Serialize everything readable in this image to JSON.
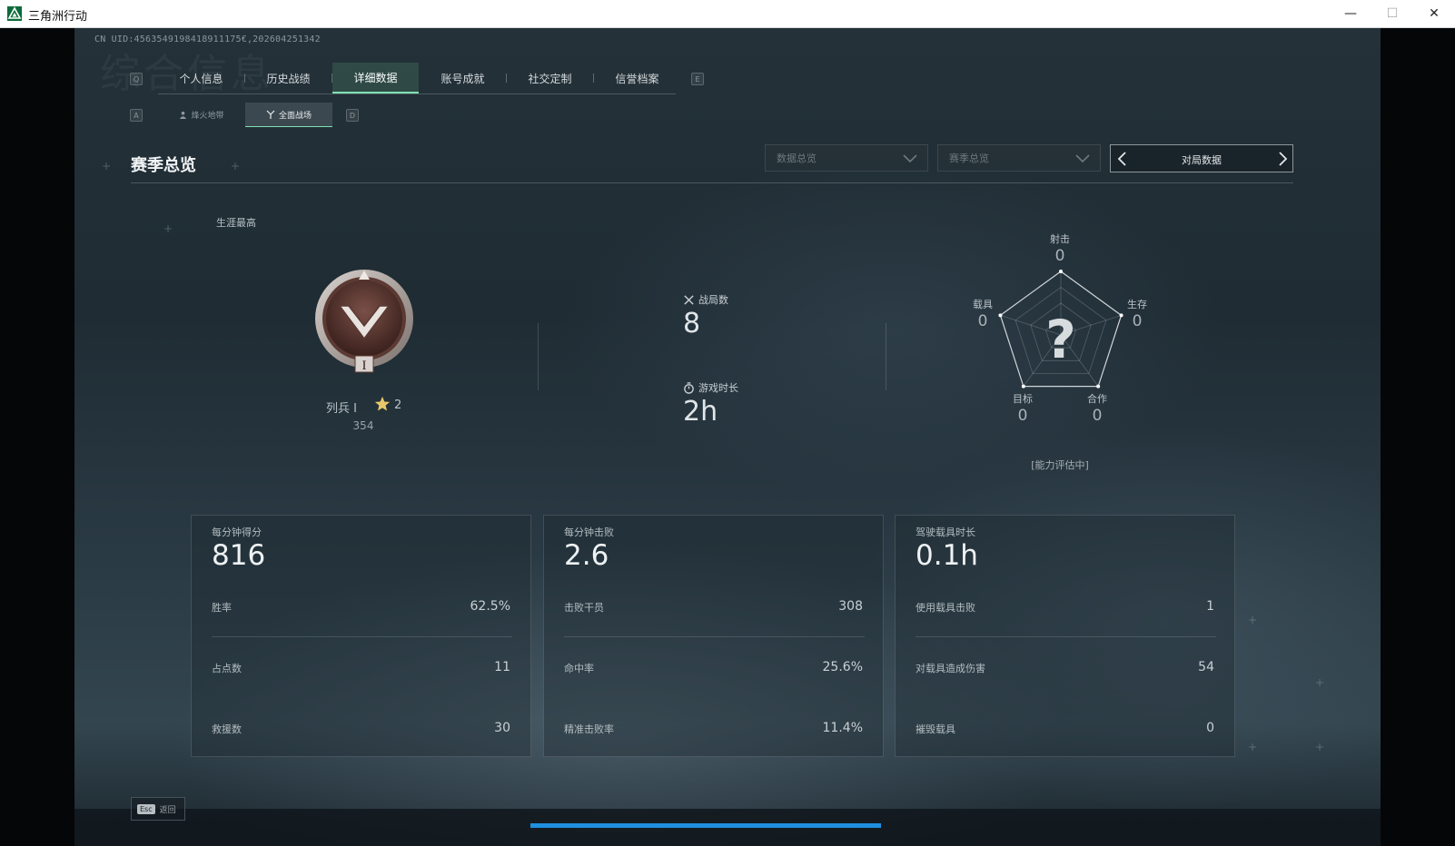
{
  "window": {
    "title": "三角洲行动",
    "min": "—",
    "max": "☐",
    "close": "✕"
  },
  "header": {
    "uid": "CN UID:4563549198418911175€,202604251342",
    "ghost_title": "综合信息"
  },
  "tabs": {
    "key_left": "Q",
    "key_right": "E",
    "items": [
      {
        "label": "个人信息"
      },
      {
        "label": "历史战绩"
      },
      {
        "label": "详细数据"
      },
      {
        "label": "账号成就"
      },
      {
        "label": "社交定制"
      },
      {
        "label": "信誉档案"
      }
    ],
    "active": "详细数据"
  },
  "subtabs": {
    "key_left": "A",
    "key_right": "D",
    "items": [
      {
        "label": "烽火地带"
      },
      {
        "label": "全面战场"
      }
    ],
    "active": "全面战场"
  },
  "section": {
    "title": "赛季总览",
    "dropdown1": "数据总览",
    "dropdown2": "赛季总览",
    "pager_label": "对局数据"
  },
  "career": {
    "label": "生涯最高",
    "rank_name": "列兵 I",
    "stars": "2",
    "points": "354",
    "badge_numeral": "I"
  },
  "stats": {
    "matches_label": "战局数",
    "matches_value": "8",
    "playtime_label": "游戏时长",
    "playtime_value": "2h"
  },
  "radar": {
    "shooting": {
      "label": "射击",
      "value": "0"
    },
    "survival": {
      "label": "生存",
      "value": "0"
    },
    "teamwork": {
      "label": "合作",
      "value": "0"
    },
    "objective": {
      "label": "目标",
      "value": "0"
    },
    "vehicle": {
      "label": "载具",
      "value": "0"
    },
    "center_mark": "?",
    "note": "[能力评估中]"
  },
  "cards": [
    {
      "title": "每分钟得分",
      "big": "816",
      "rows": [
        {
          "label": "胜率",
          "value": "62.5%"
        },
        {
          "label": "占点数",
          "value": "11"
        },
        {
          "label": "救援数",
          "value": "30"
        }
      ]
    },
    {
      "title": "每分钟击败",
      "big": "2.6",
      "rows": [
        {
          "label": "击败干员",
          "value": "308"
        },
        {
          "label": "命中率",
          "value": "25.6%"
        },
        {
          "label": "精准击败率",
          "value": "11.4%"
        }
      ]
    },
    {
      "title": "驾驶载具时长",
      "big": "0.1h",
      "rows": [
        {
          "label": "使用载具击败",
          "value": "1"
        },
        {
          "label": "对载具造成伤害",
          "value": "54"
        },
        {
          "label": "摧毁载具",
          "value": "0"
        }
      ]
    }
  ],
  "footer": {
    "esc_key": "Esc",
    "esc_label": "返回"
  },
  "colors": {
    "accent": "#7fe0b1",
    "progress": "#1f8fe0"
  }
}
